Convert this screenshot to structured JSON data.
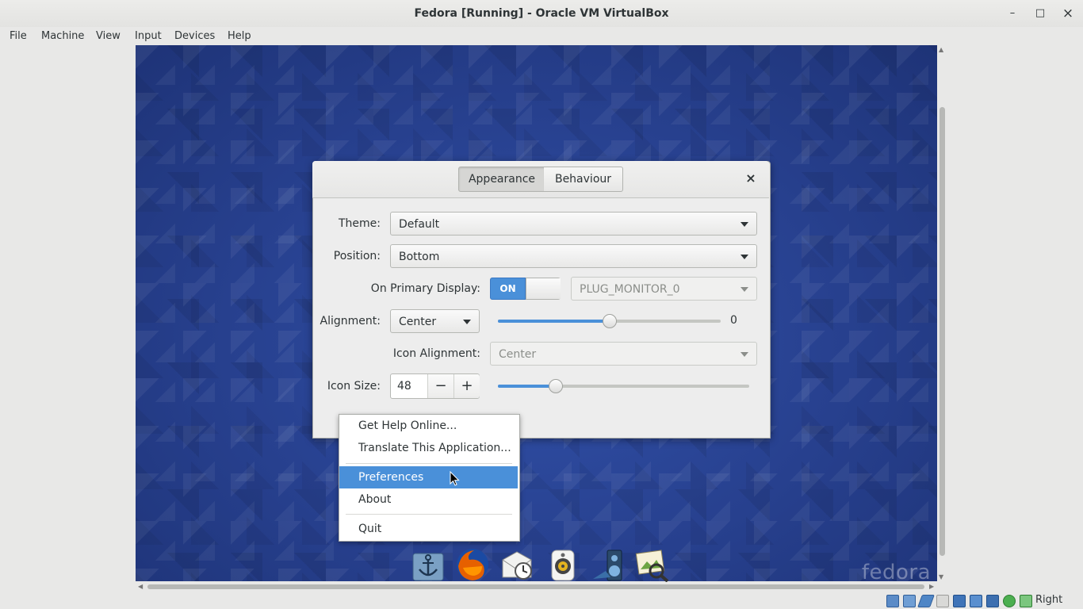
{
  "window": {
    "title": "Fedora [Running] - Oracle VM VirtualBox",
    "controls": {
      "minimize": "–",
      "maximize": "□",
      "close": "×"
    }
  },
  "menubar": {
    "items": [
      "File",
      "Machine",
      "View",
      "Input",
      "Devices",
      "Help"
    ]
  },
  "dialog": {
    "tabs": [
      {
        "label": "Appearance",
        "active": true
      },
      {
        "label": "Behaviour",
        "active": false
      }
    ],
    "close_label": "×",
    "theme": {
      "label": "Theme:",
      "value": "Default"
    },
    "position": {
      "label": "Position:",
      "value": "Bottom"
    },
    "primary_display": {
      "label": "On Primary Display:",
      "switch_text": "ON",
      "switch_on": true,
      "monitor_value": "PLUG_MONITOR_0"
    },
    "alignment": {
      "label": "Alignment:",
      "value": "Center",
      "offset_value": "0",
      "offset_fraction": 0.5
    },
    "icon_alignment": {
      "label": "Icon Alignment:",
      "value": "Center"
    },
    "icon_size": {
      "label": "Icon Size:",
      "value": "48",
      "minus": "−",
      "plus": "+",
      "slider_fraction": 0.23
    }
  },
  "context_menu": {
    "items": [
      {
        "label": "Get Help Online..."
      },
      {
        "label": "Translate This Application..."
      },
      {
        "label": "Preferences",
        "highlighted": true
      },
      {
        "label": "About"
      },
      {
        "label": "Quit"
      }
    ]
  },
  "guest": {
    "watermark": "fedora",
    "dock_icons": [
      "anchor-icon",
      "firefox-icon",
      "mail-clock-icon",
      "speaker-icon",
      "media-player-icon",
      "image-viewer-icon"
    ]
  },
  "statusbar": {
    "host_key_label": "Right Ctrl",
    "icons": [
      "hard-disk-icon",
      "optical-drive-icon",
      "audio-icon",
      "network-icon",
      "usb-icon",
      "shared-folders-icon",
      "display-icon",
      "video-capture-icon",
      "cpu-icon",
      "mouse-integration-icon",
      "keyboard-icon"
    ]
  },
  "colors": {
    "accent": "#4a90d9",
    "desktop": "#27408e",
    "window_bg": "#e8e8e7"
  }
}
